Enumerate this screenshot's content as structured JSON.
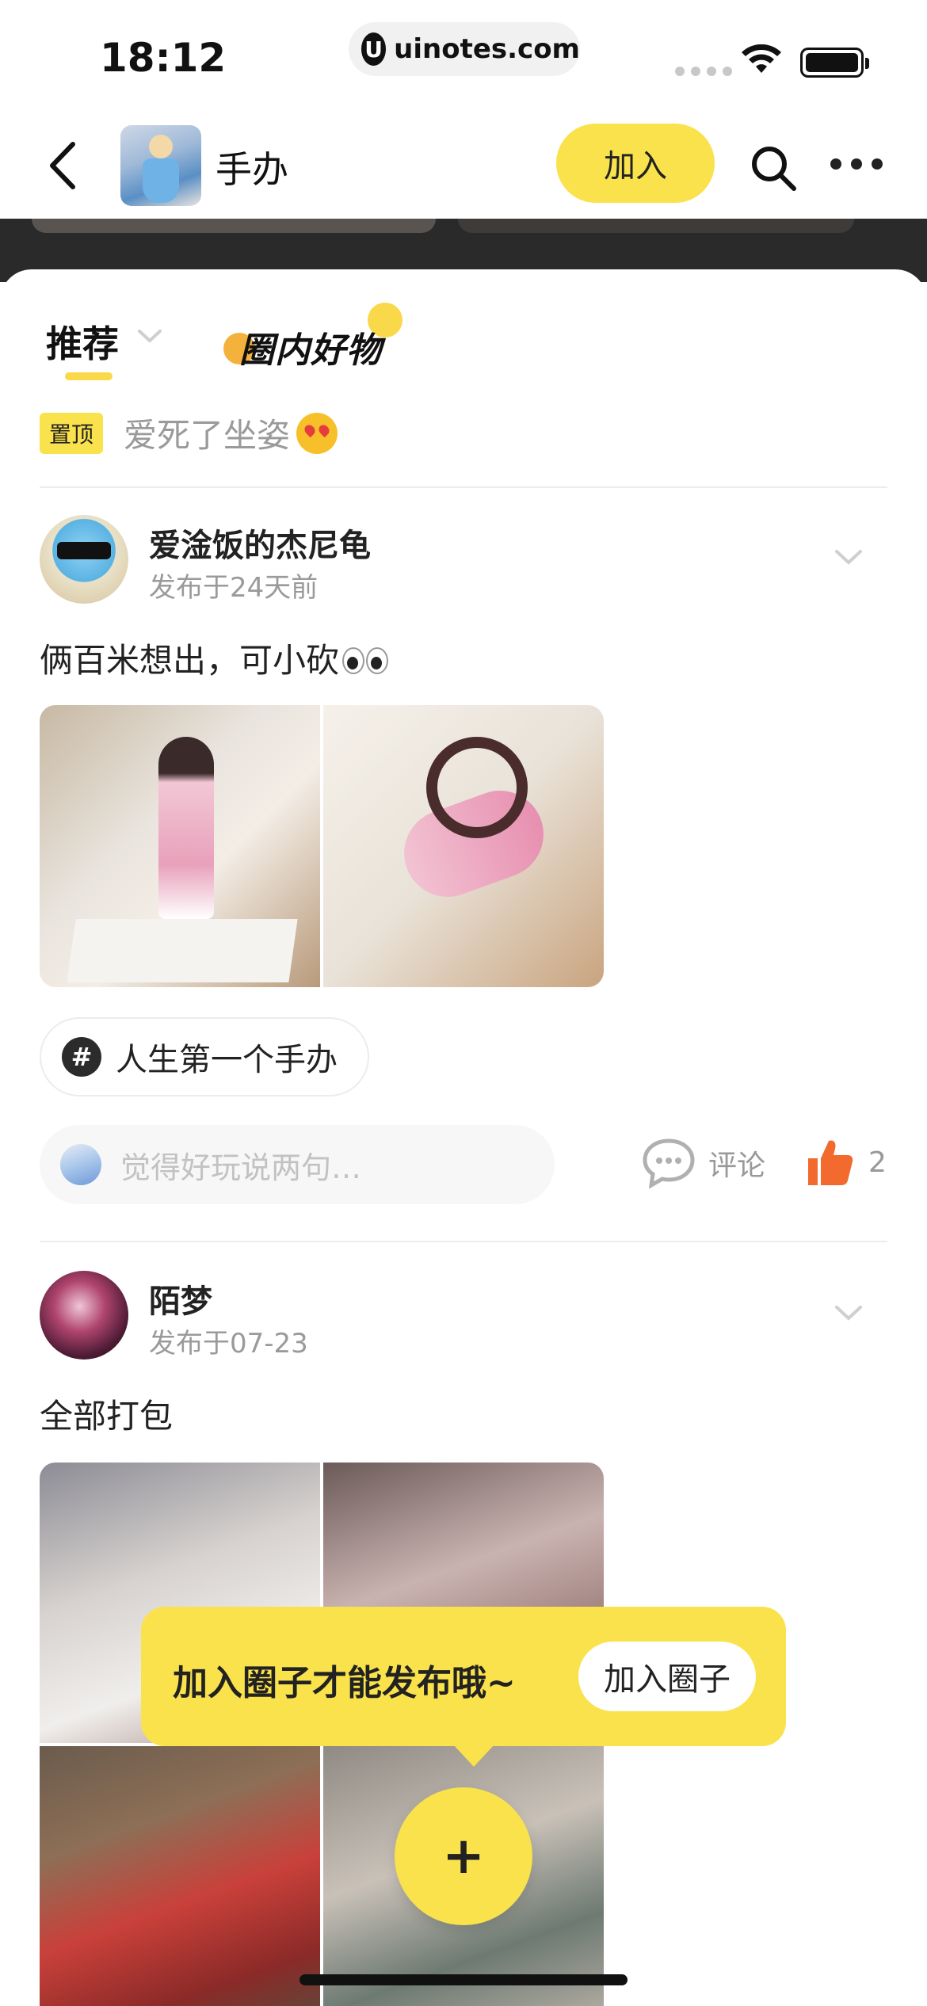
{
  "status_bar": {
    "time": "18:12",
    "url": "uinotes.com",
    "url_logo": "U"
  },
  "header": {
    "circle_name": "手办",
    "join_label": "加入",
    "icons": [
      "back-icon",
      "search-icon",
      "more-icon"
    ]
  },
  "tabs": {
    "recommend": "推荐",
    "goods": "圈内好物"
  },
  "pinned": {
    "badge": "置顶",
    "text": "爱死了坐姿"
  },
  "posts": [
    {
      "author": "爱淦饭的杰尼龟",
      "time": "发布于24天前",
      "content": "俩百米想出，可小砍",
      "topic": "人生第一个手办",
      "comment_placeholder": "觉得好玩说两句…",
      "comment_label": "评论",
      "like_count": "2"
    },
    {
      "author": "陌梦",
      "time": "发布于07-23",
      "content": "全部打包"
    }
  ],
  "toast": {
    "text": "加入圈子才能发布哦~",
    "button": "加入圈子"
  },
  "fab": {
    "label": "+"
  },
  "colors": {
    "accent_yellow": "#f9e24b",
    "like_orange": "#f26a2e",
    "text_dark": "#222222",
    "text_muted": "#9a9a9a"
  }
}
